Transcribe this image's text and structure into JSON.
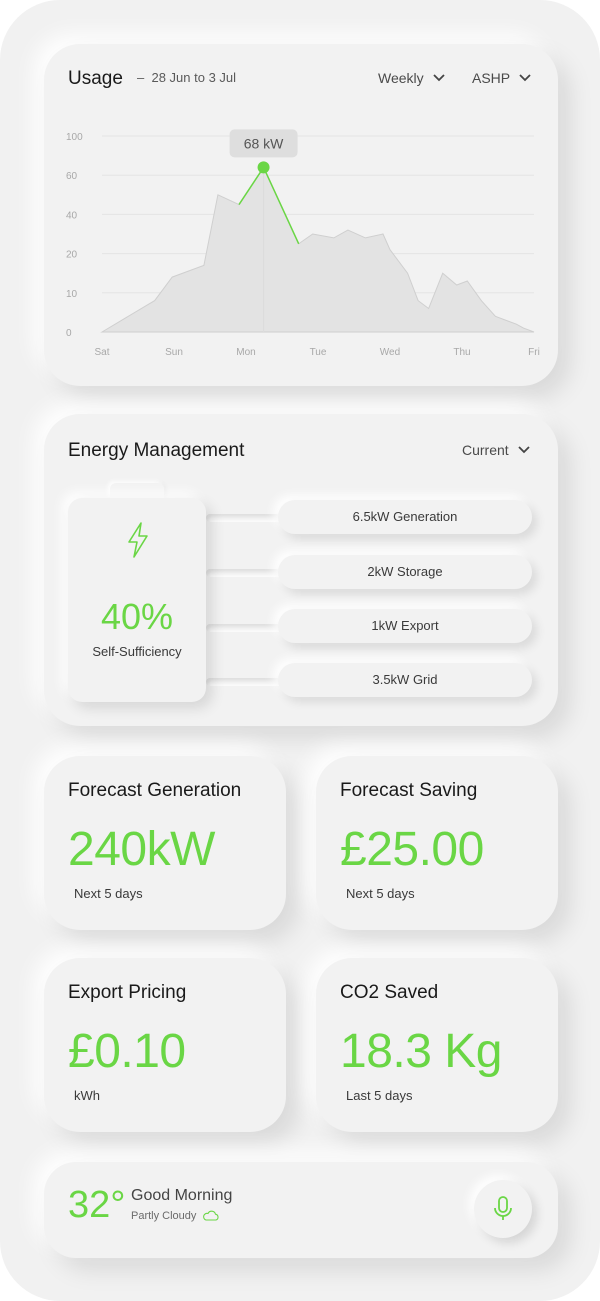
{
  "usage": {
    "title": "Usage",
    "date_range": "28 Jun to 3 Jul",
    "period_select": "Weekly",
    "source_select": "ASHP",
    "tooltip": "68 kW"
  },
  "chart_data": {
    "type": "area",
    "title": "Usage",
    "xlabel": "",
    "ylabel": "",
    "categories": [
      "Sat",
      "Sun",
      "Mon",
      "Tue",
      "Wed",
      "Thu",
      "Fri"
    ],
    "y_ticks": [
      "0",
      "10",
      "20",
      "40",
      "60",
      "100"
    ],
    "x": [
      0,
      0.75,
      1.0,
      1.45,
      1.65,
      1.95,
      2.3,
      2.8,
      3.0,
      3.3,
      3.5,
      3.75,
      4.0,
      4.1,
      4.35,
      4.5,
      4.65,
      4.85,
      5.05,
      5.2,
      5.4,
      5.6,
      5.9,
      6.0,
      6.15
    ],
    "values": [
      0,
      8,
      14,
      17,
      50,
      45,
      68,
      25,
      30,
      28,
      32,
      28,
      30,
      22,
      15,
      8,
      6,
      15,
      12,
      13,
      8,
      4,
      2,
      1,
      0
    ],
    "highlight": {
      "x": 2.3,
      "value": 68,
      "label": "68 kW"
    },
    "accent_color": "#6ad645",
    "grid": true
  },
  "energy": {
    "title": "Energy Management",
    "select": "Current",
    "percent": "40%",
    "caption": "Self-Sufficiency",
    "flows": [
      "6.5kW Generation",
      "2kW Storage",
      "1kW Export",
      "3.5kW Grid"
    ]
  },
  "forecast_generation": {
    "title": "Forecast Generation",
    "value": "240kW",
    "sub": "Next 5 days"
  },
  "forecast_saving": {
    "title": "Forecast Saving",
    "value": "£25.00",
    "sub": "Next 5 days"
  },
  "export_pricing": {
    "title": "Export Pricing",
    "value": "£0.10",
    "sub": "kWh"
  },
  "co2_saved": {
    "title": "CO2 Saved",
    "value": "18.3 Kg",
    "sub": "Last 5 days"
  },
  "weather": {
    "temperature": "32°",
    "greeting": "Good Morning",
    "condition": "Partly Cloudy",
    "icon": "cloud-icon"
  },
  "colors": {
    "accent": "#6ad645",
    "background": "#f1f1f1"
  }
}
